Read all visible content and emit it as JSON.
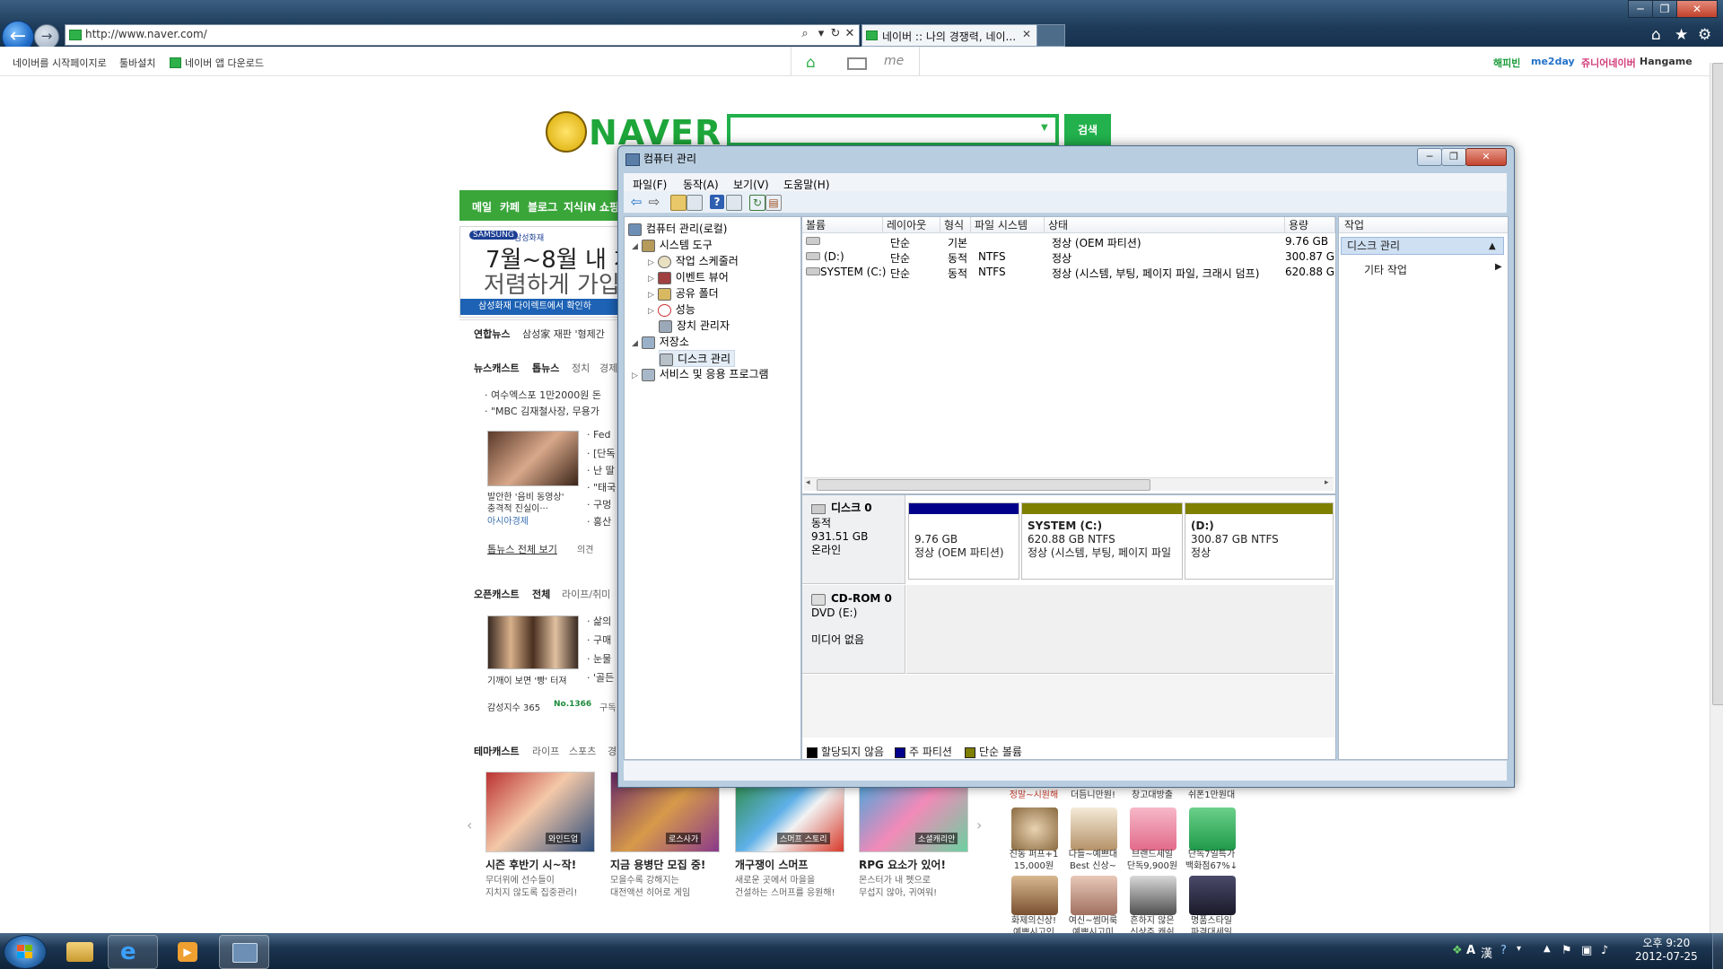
{
  "browser": {
    "url": "http://www.naver.com/",
    "tab_title": "네이버 :: 나의 경쟁력, 네이...",
    "tab_close": "✕",
    "nav_back": "←",
    "nav_fwd": "→",
    "win_min": "─",
    "win_max": "❐",
    "win_close": "✕",
    "favorites": [
      "네이버를 시작페이지로",
      "툴바설치",
      "네이버 앱 다운로드"
    ],
    "brands": [
      "해피빈",
      "me2day",
      "쥬니어네이버",
      "Hangame"
    ],
    "me_label": "me"
  },
  "naver": {
    "logo": "NAVER",
    "search_button": "검색",
    "nav_items": [
      "메일",
      "카페",
      "블로그",
      "지식iN",
      "쇼핑"
    ],
    "ad": {
      "brand": "SAMSUNG",
      "brand_sub": "삼성화재",
      "line1": "7월~8월 내 차",
      "line2": "저렴하게 가입",
      "line3": "삼성화재 다이렉트에서 확인하"
    },
    "yonhap": {
      "label": "연합뉴스",
      "text": "삼성家 재판 '형제간"
    },
    "newscast": {
      "label": "뉴스캐스트",
      "tab_top": "톱뉴스",
      "tab_politics": "정치",
      "tab_economy": "경제",
      "lines": [
        "· 여수엑스포 1만2000원 돈",
        "· \"MBC 김재철사장, 무용가"
      ],
      "side_lines": [
        "· Fed",
        "· [단독",
        "· 난 딸",
        "· \"태국",
        "· 구멍",
        "· 홍산"
      ],
      "photo_caption": [
        "발안한 '음비 동영상'",
        "충격적 진실이···"
      ],
      "photo_source": "아시아경제",
      "more": "톱뉴스 전체 보기",
      "opinion": "의견"
    },
    "opencast": {
      "label": "오픈캐스트",
      "tab_all": "전체",
      "tab_life": "라이프/취미",
      "side_lines": [
        "· 삶의",
        "· 구매",
        "· 눈물",
        "· '골든"
      ],
      "caption": "기깨이 보면 '빵' 터져",
      "index_label": "감성지수 365",
      "index_no": "No.1366",
      "index_more": "구독"
    },
    "themecast": {
      "label": "테마캐스트",
      "tabs": [
        "라이프",
        "스포츠",
        "경"
      ],
      "items": [
        {
          "badge": "와인드업",
          "title": "시즌 후반기 시~작!",
          "desc": "무더위에 선수들이\n지치지 않도록 집중관리!"
        },
        {
          "badge": "로스사가",
          "title": "지금 용병단 모집 중!",
          "desc": "모을수록 강해지는\n대전액션 히어로 게임"
        },
        {
          "badge": "스머프 스토리",
          "title": "개구쟁이 스머프",
          "desc": "새로운 곳에서 마을을\n건설하는 스머프를 응원해!"
        },
        {
          "badge": "소셜캐리안",
          "title": "RPG 요소가 있어!",
          "desc": "몬스터가 내 펫으로\n무섭지 않아, 귀여워!"
        }
      ]
    },
    "shopping": {
      "top_labels": [
        "정말~시원해",
        "더듬니만원!",
        "창고대방출",
        "쉬폰1만원대"
      ],
      "row1": [
        "진동 퍼프+1\n15,000원",
        "다들~예쁘대\nBest 신상~",
        "브랜드세일\n단독9,900원",
        "단독7일특가\n백화점67%↓"
      ],
      "row2": [
        "화제의신상!\n예쁘시고인",
        "여신~썸머룩\n예쁘시고미",
        "흔하지 않은\n신상주 캐쉬",
        "명품스타일\n파격대세일"
      ]
    }
  },
  "compmgmt": {
    "title": "컴퓨터 관리",
    "menus": [
      "파일(F)",
      "동작(A)",
      "보기(V)",
      "도움말(H)"
    ],
    "tree": {
      "root": "컴퓨터 관리(로컬)",
      "system_tools": "시스템 도구",
      "task_scheduler": "작업 스케줄러",
      "event_viewer": "이벤트 뷰어",
      "shared_folders": "공유 폴더",
      "performance": "성능",
      "device_manager": "장치 관리자",
      "storage": "저장소",
      "disk_management": "디스크 관리",
      "services": "서비스 및 응용 프로그램"
    },
    "volume_columns": [
      "볼륨",
      "레이아웃",
      "형식",
      "파일 시스템",
      "상태",
      "용량"
    ],
    "volumes": [
      {
        "volume": "",
        "layout": "단순",
        "type": "기본",
        "fs": "",
        "status": "정상 (OEM 파티션)",
        "capacity": "9.76 GB"
      },
      {
        "volume": "(D:)",
        "layout": "단순",
        "type": "동적",
        "fs": "NTFS",
        "status": "정상",
        "capacity": "300.87 GB"
      },
      {
        "volume": "SYSTEM (C:)",
        "layout": "단순",
        "type": "동적",
        "fs": "NTFS",
        "status": "정상 (시스템, 부팅, 페이지 파일, 크래시 덤프)",
        "capacity": "620.88 GB"
      }
    ],
    "disk0": {
      "name": "디스크 0",
      "type": "동적",
      "size": "931.51 GB",
      "state": "온라인"
    },
    "partitions": [
      {
        "name": "",
        "size": "9.76 GB",
        "status": "정상 (OEM 파티션)"
      },
      {
        "name": "SYSTEM  (C:)",
        "size": "620.88 GB NTFS",
        "status": "정상 (시스템, 부팅, 페이지 파일"
      },
      {
        "name": "(D:)",
        "size": "300.87 GB NTFS",
        "status": "정상"
      }
    ],
    "cdrom": {
      "name": "CD-ROM 0",
      "type": "DVD (E:)",
      "state": "미디어 없음"
    },
    "legend": [
      "할당되지 않음",
      "주 파티션",
      "단순 볼륨"
    ],
    "actions_header": "작업",
    "actions_selected": "디스크 관리",
    "actions_more": "기타 작업",
    "colors": {
      "unallocated": "#000000",
      "primary": "#00008b",
      "simple": "#7f7f00"
    }
  },
  "taskbar": {
    "ime_a": "A",
    "ime_han": "漢",
    "time": "오후 9:20",
    "date": "2012-07-25"
  }
}
